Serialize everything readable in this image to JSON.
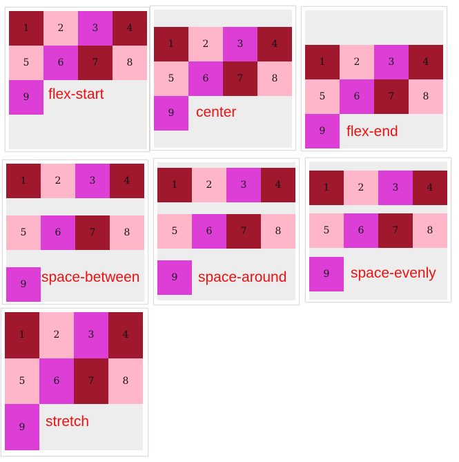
{
  "colors": {
    "dark_red": "#a0182e",
    "pink": "#ffb6c9",
    "magenta": "#dc3ed6",
    "label_red": "#ee1111",
    "area_gray": "#ededed"
  },
  "items": [
    {
      "label": "1",
      "color": "dark_red"
    },
    {
      "label": "2",
      "color": "pink"
    },
    {
      "label": "3",
      "color": "magenta"
    },
    {
      "label": "4",
      "color": "dark_red"
    },
    {
      "label": "5",
      "color": "pink"
    },
    {
      "label": "6",
      "color": "magenta"
    },
    {
      "label": "7",
      "color": "dark_red"
    },
    {
      "label": "8",
      "color": "pink"
    },
    {
      "label": "9",
      "color": "magenta"
    }
  ],
  "examples": [
    {
      "name": "flex-start",
      "align_content": "flex-start"
    },
    {
      "name": "center",
      "align_content": "center"
    },
    {
      "name": "flex-end",
      "align_content": "flex-end"
    },
    {
      "name": "space-between",
      "align_content": "space-between"
    },
    {
      "name": "space-around",
      "align_content": "space-around"
    },
    {
      "name": "space-evenly",
      "align_content": "space-evenly"
    },
    {
      "name": "stretch",
      "align_content": "stretch"
    }
  ]
}
